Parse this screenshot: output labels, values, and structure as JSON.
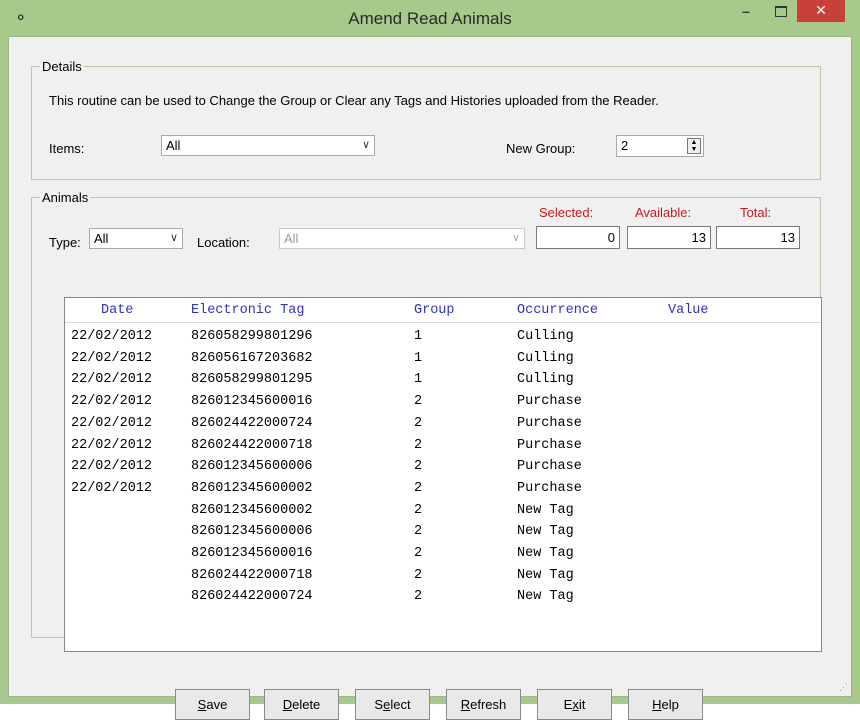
{
  "window": {
    "title": "Amend Read Animals",
    "icon": "tag-reader-icon",
    "min_label": "–",
    "close_label": "✕"
  },
  "details": {
    "legend": "Details",
    "description": "This routine can be used to Change the Group or Clear any Tags and Histories uploaded from the Reader.",
    "items_label": "Items:",
    "items_value": "All",
    "new_group_label": "New Group:",
    "new_group_value": "2"
  },
  "animals": {
    "legend": "Animals",
    "type_label": "Type:",
    "type_value": "All",
    "location_label": "Location:",
    "location_value": "All",
    "selected_label": "Selected:",
    "selected_value": "0",
    "available_label": "Available:",
    "available_value": "13",
    "total_label": "Total:",
    "total_value": "13",
    "label_color": "#cc1a1a"
  },
  "list": {
    "columns": [
      "Date",
      "Electronic Tag",
      "Group",
      "Occurrence",
      "Value"
    ],
    "rows": [
      [
        "22/02/2012",
        "826058299801296",
        "1",
        "Culling",
        ""
      ],
      [
        "22/02/2012",
        "826056167203682",
        "1",
        "Culling",
        ""
      ],
      [
        "22/02/2012",
        "826058299801295",
        "1",
        "Culling",
        ""
      ],
      [
        "22/02/2012",
        "826012345600016",
        "2",
        "Purchase",
        ""
      ],
      [
        "22/02/2012",
        "826024422000724",
        "2",
        "Purchase",
        ""
      ],
      [
        "22/02/2012",
        "826024422000718",
        "2",
        "Purchase",
        ""
      ],
      [
        "22/02/2012",
        "826012345600006",
        "2",
        "Purchase",
        ""
      ],
      [
        "22/02/2012",
        "826012345600002",
        "2",
        "Purchase",
        ""
      ],
      [
        "",
        "826012345600002",
        "2",
        "New Tag",
        ""
      ],
      [
        "",
        "826012345600006",
        "2",
        "New Tag",
        ""
      ],
      [
        "",
        "826012345600016",
        "2",
        "New Tag",
        ""
      ],
      [
        "",
        "826024422000718",
        "2",
        "New Tag",
        ""
      ],
      [
        "",
        "826024422000724",
        "2",
        "New Tag",
        ""
      ]
    ],
    "header_color": "#3030c8"
  },
  "buttons": [
    {
      "pre": "",
      "key": "S",
      "post": "ave",
      "name": "save-button"
    },
    {
      "pre": "",
      "key": "D",
      "post": "elete",
      "name": "delete-button"
    },
    {
      "pre": "S",
      "key": "e",
      "post": "lect",
      "name": "select-button"
    },
    {
      "pre": "",
      "key": "R",
      "post": "efresh",
      "name": "refresh-button"
    },
    {
      "pre": "E",
      "key": "x",
      "post": "it",
      "name": "exit-button"
    },
    {
      "pre": "",
      "key": "H",
      "post": "elp",
      "name": "help-button"
    }
  ],
  "colors": {
    "title_bar": "#a8c98c",
    "close_button": "#c7403a",
    "dialog_bg": "#f0f0f0"
  }
}
